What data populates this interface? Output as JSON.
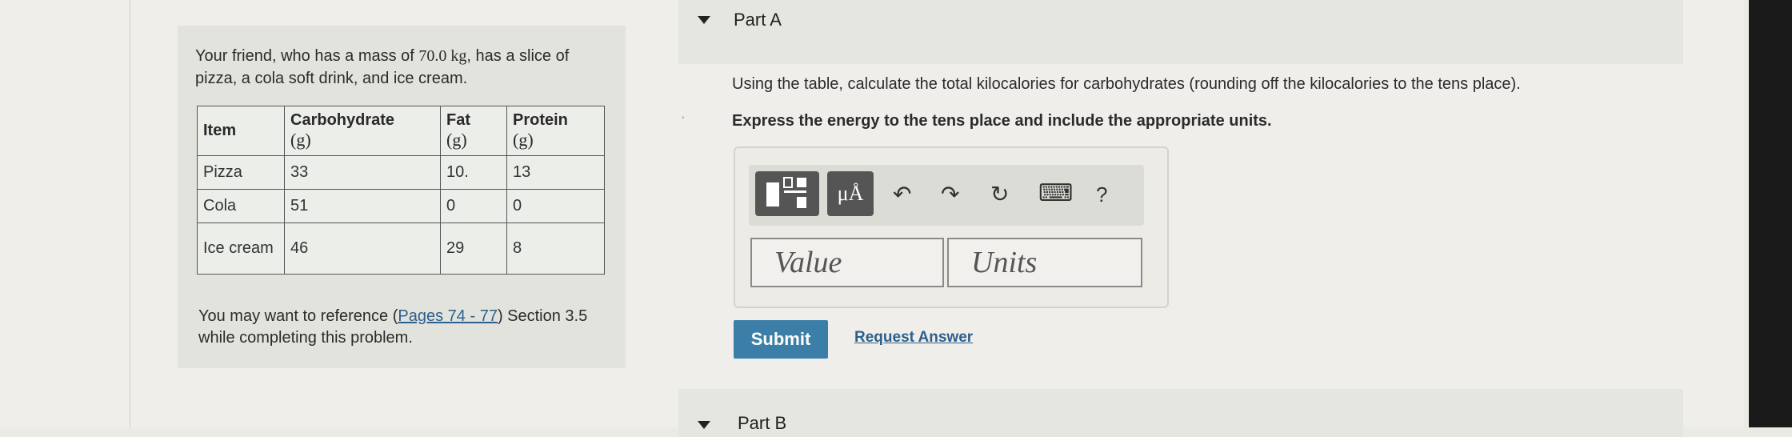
{
  "context": {
    "intro_pre": "Your friend, who has a mass of ",
    "intro_mass": "70.0 kg",
    "intro_post": ", has a slice of pizza, a cola soft drink, and ice cream.",
    "table": {
      "headers": [
        {
          "name": "Item",
          "unit": ""
        },
        {
          "name": "Carbohydrate",
          "unit": "(g)"
        },
        {
          "name": "Fat",
          "unit": "(g)"
        },
        {
          "name": "Protein",
          "unit": "(g)"
        }
      ],
      "rows": [
        [
          "Pizza",
          "33",
          "10.",
          "13"
        ],
        [
          "Cola",
          "51",
          "0",
          "0"
        ],
        [
          "Ice cream",
          "46",
          "29",
          "8"
        ]
      ]
    },
    "reference_pre": "You may want to reference (",
    "reference_link": "Pages 74 - 77",
    "reference_post": ") Section 3.5 while completing this problem."
  },
  "partA": {
    "label": "Part A",
    "question": "Using the table, calculate the total kilocalories for carbohydrates (rounding off the kilocalories to the tens place).",
    "instruction": "Express the energy to the tens place and include the appropriate units.",
    "toolbar": {
      "units_button": "μÅ",
      "undo_icon": "↶",
      "redo_icon": "↷",
      "reset_icon": "↻",
      "keyboard_icon": "⌨",
      "help_icon": "?"
    },
    "value_placeholder": "Value",
    "units_placeholder": "Units",
    "submit_label": "Submit",
    "request_answer_label": "Request Answer"
  },
  "partB": {
    "label": "Part B"
  }
}
